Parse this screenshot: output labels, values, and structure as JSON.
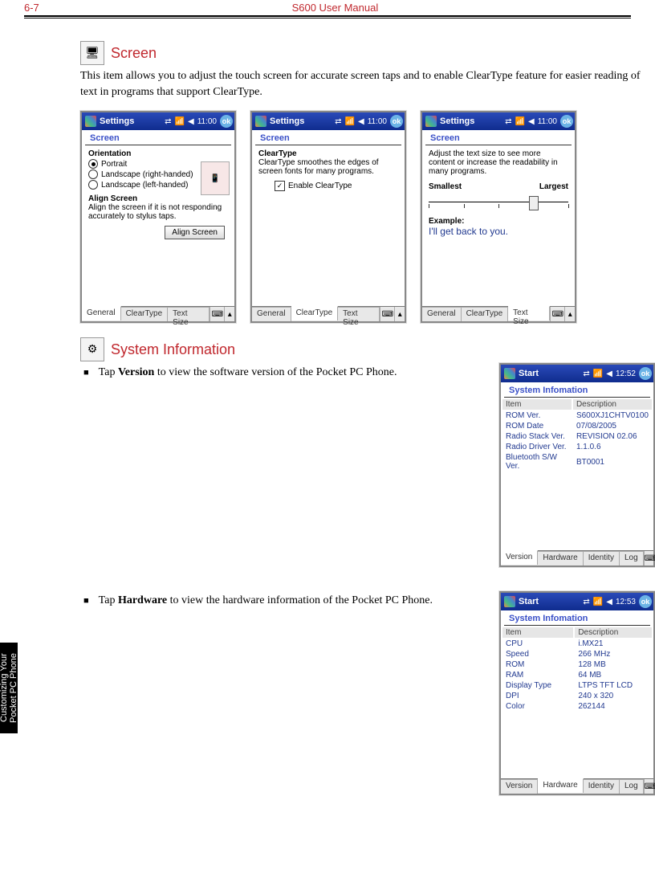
{
  "header": {
    "page_num": "6-7",
    "title": "S600 User Manual"
  },
  "side_tab": "Customizing Your Pocket PC Phone",
  "screen_section": {
    "heading": "Screen",
    "intro": "This item allows you to adjust the touch screen for accurate screen taps and to enable ClearType feature for easier reading of text in programs that support ClearType."
  },
  "sysinfo_section": {
    "heading": "System Information",
    "bullet1_pre": "Tap ",
    "bullet1_b": "Version",
    "bullet1_post": " to view the software version of the Pocket PC Phone.",
    "bullet2_pre": "Tap ",
    "bullet2_b": "Hardware",
    "bullet2_post": " to view the hardware information of the Pocket PC Phone."
  },
  "common": {
    "settings_title": "Settings",
    "start_title": "Start",
    "time1": "11:00",
    "time2": "12:52",
    "time3": "12:53",
    "ok": "ok",
    "kb_icon": "⌨",
    "up_icon": "▴",
    "signal_icon": "📶",
    "sound_icon": "◀",
    "conn_icon": "⇄"
  },
  "shot_general": {
    "subtitle": "Screen",
    "orientation_h": "Orientation",
    "opt_portrait": "Portrait",
    "opt_land_r": "Landscape (right-handed)",
    "opt_land_l": "Landscape (left-handed)",
    "align_h": "Align Screen",
    "align_desc": "Align the screen if it is not responding accurately to stylus taps.",
    "align_btn": "Align Screen",
    "tabs": {
      "t1": "General",
      "t2": "ClearType",
      "t3": "Text Size"
    }
  },
  "shot_cleartype": {
    "subtitle": "Screen",
    "ct_h": "ClearType",
    "ct_desc": "ClearType smoothes the edges of screen fonts for many programs.",
    "ct_check": "Enable ClearType",
    "tabs": {
      "t1": "General",
      "t2": "ClearType",
      "t3": "Text Size"
    }
  },
  "shot_textsize": {
    "subtitle": "Screen",
    "desc": "Adjust the text size to see more content or increase the readability in many programs.",
    "smallest": "Smallest",
    "largest": "Largest",
    "example_h": "Example:",
    "example_text": "I'll get back to you.",
    "tabs": {
      "t1": "General",
      "t2": "ClearType",
      "t3": "Text Size"
    }
  },
  "shot_version": {
    "subtitle": "System Infomation",
    "col_item": "Item",
    "col_desc": "Description",
    "rows": [
      {
        "item": "ROM Ver.",
        "desc": "S600XJ1CHTV0100"
      },
      {
        "item": "ROM Date",
        "desc": "07/08/2005"
      },
      {
        "item": "Radio Stack Ver.",
        "desc": "REVISION 02.06"
      },
      {
        "item": "Radio Driver Ver.",
        "desc": "1.1.0.6"
      },
      {
        "item": "Bluetooth S/W Ver.",
        "desc": "BT0001"
      }
    ],
    "tabs": {
      "t1": "Version",
      "t2": "Hardware",
      "t3": "Identity",
      "t4": "Log"
    }
  },
  "shot_hardware": {
    "subtitle": "System Infomation",
    "col_item": "Item",
    "col_desc": "Description",
    "rows": [
      {
        "item": "CPU",
        "desc": "i.MX21"
      },
      {
        "item": "Speed",
        "desc": "266 MHz"
      },
      {
        "item": "ROM",
        "desc": "128 MB"
      },
      {
        "item": "RAM",
        "desc": "64 MB"
      },
      {
        "item": "Display Type",
        "desc": "LTPS TFT LCD"
      },
      {
        "item": "DPI",
        "desc": "240 x 320"
      },
      {
        "item": "Color",
        "desc": "262144"
      }
    ],
    "tabs": {
      "t1": "Version",
      "t2": "Hardware",
      "t3": "Identity",
      "t4": "Log"
    }
  }
}
